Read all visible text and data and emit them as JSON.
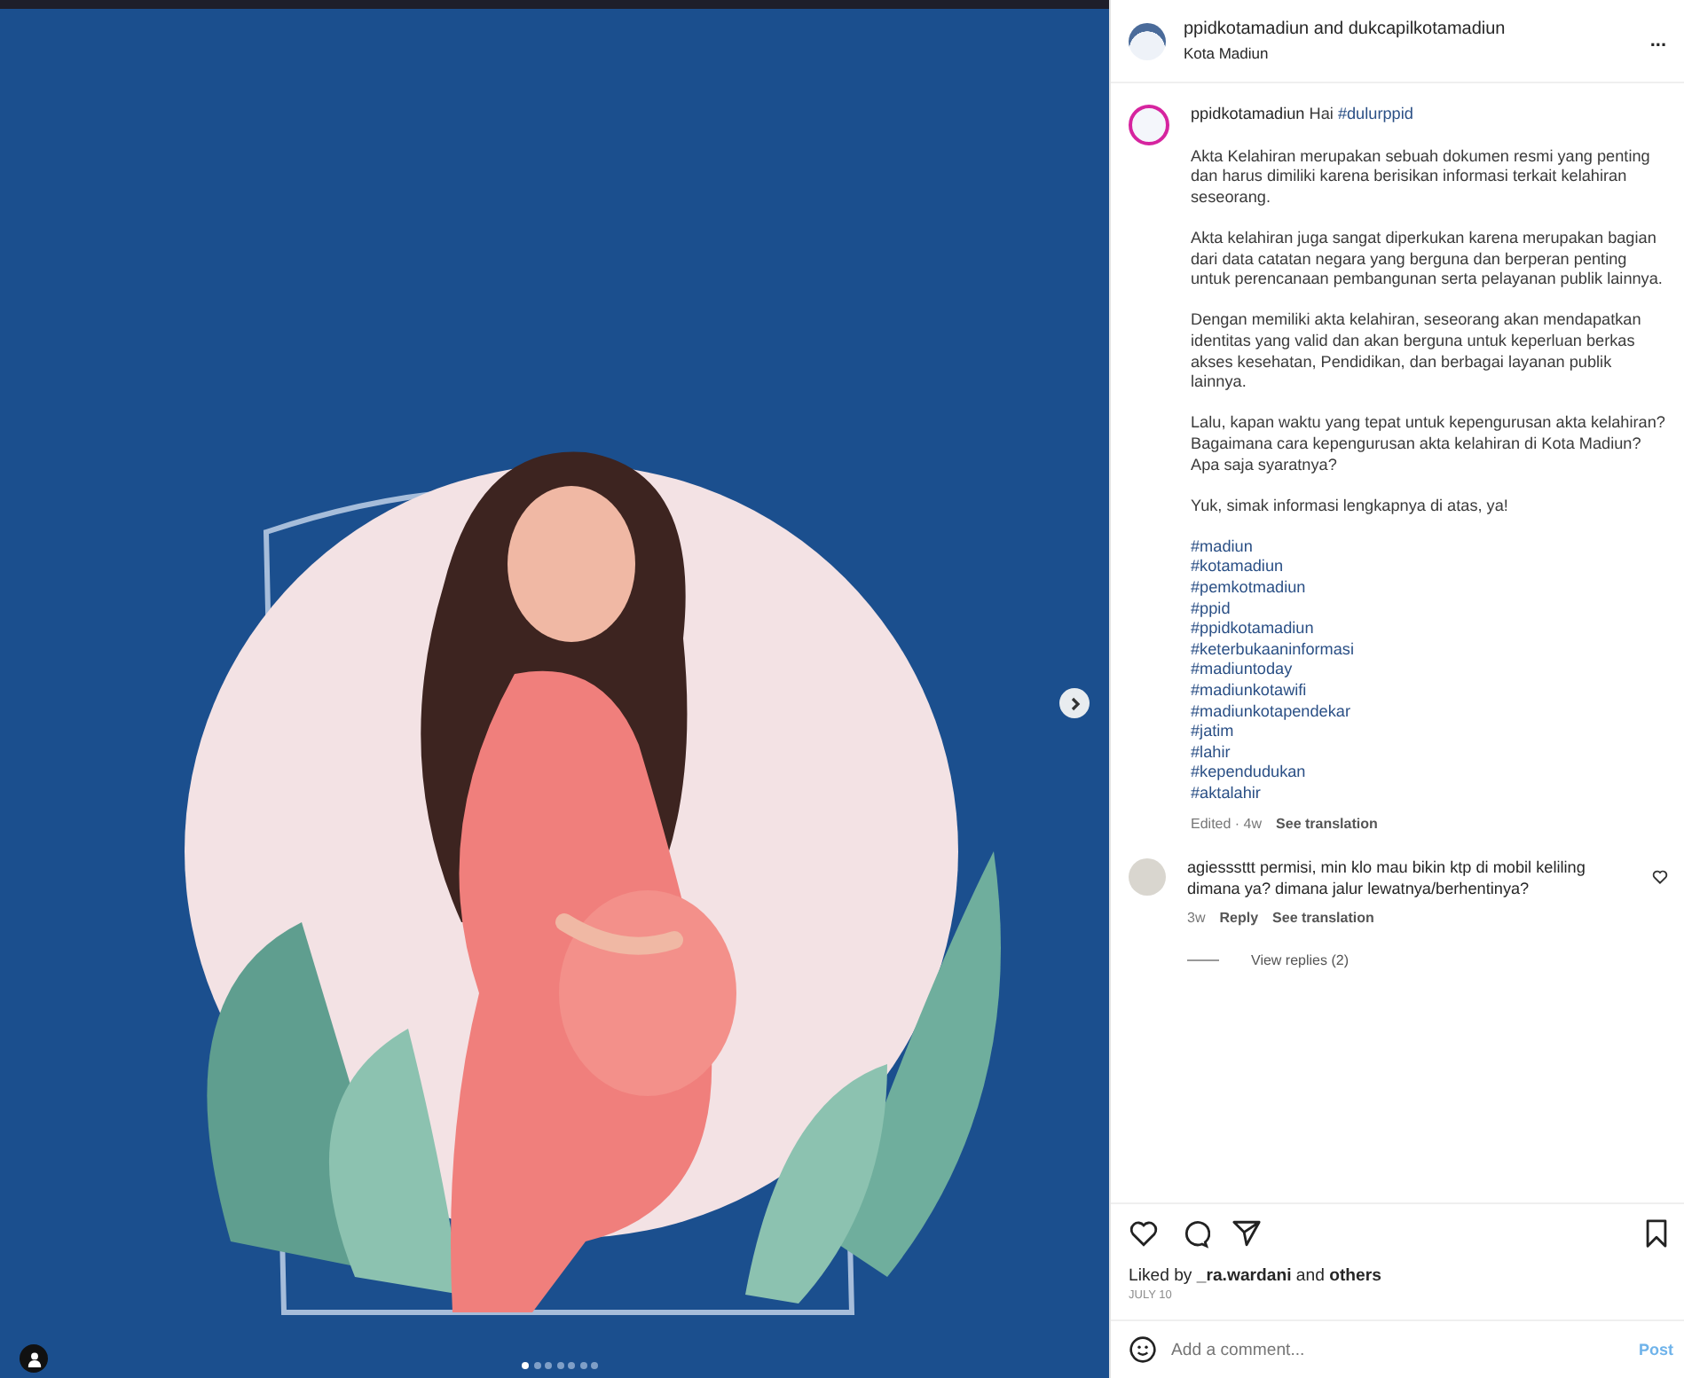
{
  "media": {
    "kind": "picture",
    "slides": [
      {
        "selected": true
      },
      {
        "selected": false
      },
      {
        "selected": false
      },
      {
        "selected": false
      },
      {
        "selected": false
      },
      {
        "selected": false
      },
      {
        "selected": false
      }
    ]
  },
  "header": {
    "account": "ppidkotamadiun and dukcapilkotamadiun",
    "location": "Kota Madiun",
    "more": "..."
  },
  "caption": {
    "username": "ppidkotamadiun",
    "greeting": "Hai",
    "tag": "#dulurppid",
    "paragraphs": [
      "Akta Kelahiran merupakan sebuah dokumen resmi yang penting dan harus dimiliki karena berisikan informasi terkait kelahiran seseorang.",
      "Akta kelahiran juga sangat diperkukan karena merupakan bagian dari data catatan negara yang berguna dan berperan penting untuk perencanaan pembangunan serta pelayanan publik lainnya.",
      "Dengan memiliki akta kelahiran, seseorang akan mendapatkan identitas yang valid dan akan berguna untuk keperluan berkas akses kesehatan, Pendidikan, dan berbagai layanan publik lainnya.",
      "Lalu, kapan waktu yang tepat untuk kepengurusan akta kelahiran?\nBagaimana cara kepengurusan akta kelahiran di Kota Madiun?\nApa saja syaratnya?",
      "Yuk, simak informasi lengkapnya di atas, ya!"
    ],
    "hashtags": [
      "#madiun",
      "#kotamadiun",
      "#pemkotmadiun",
      "#ppid",
      "#ppidkotamadiun",
      "#keterbukaaninformasi",
      "#madiuntoday",
      "#madiunkotawifi",
      "#madiunkotapendekar",
      "#jatim",
      "#lahir",
      "#kependudukan",
      "#aktalahir"
    ],
    "meta": "Edited · 4w",
    "translate": "See translation"
  },
  "comment": {
    "username": "agiesssttt",
    "text": "permisi, min klo mau bikin ktp di mobil keliling dimana ya? dimana jalur lewatnya/berhentinya?",
    "time": "3w",
    "reply": "Reply",
    "translate": "See translation",
    "replies": "View replies (2)"
  },
  "likes": "Liked by **_ra.wardani** and **others**",
  "date": "JULY 10",
  "composer": {
    "placeholder": "Add a comment...",
    "post": "Post",
    "disabled": true
  }
}
